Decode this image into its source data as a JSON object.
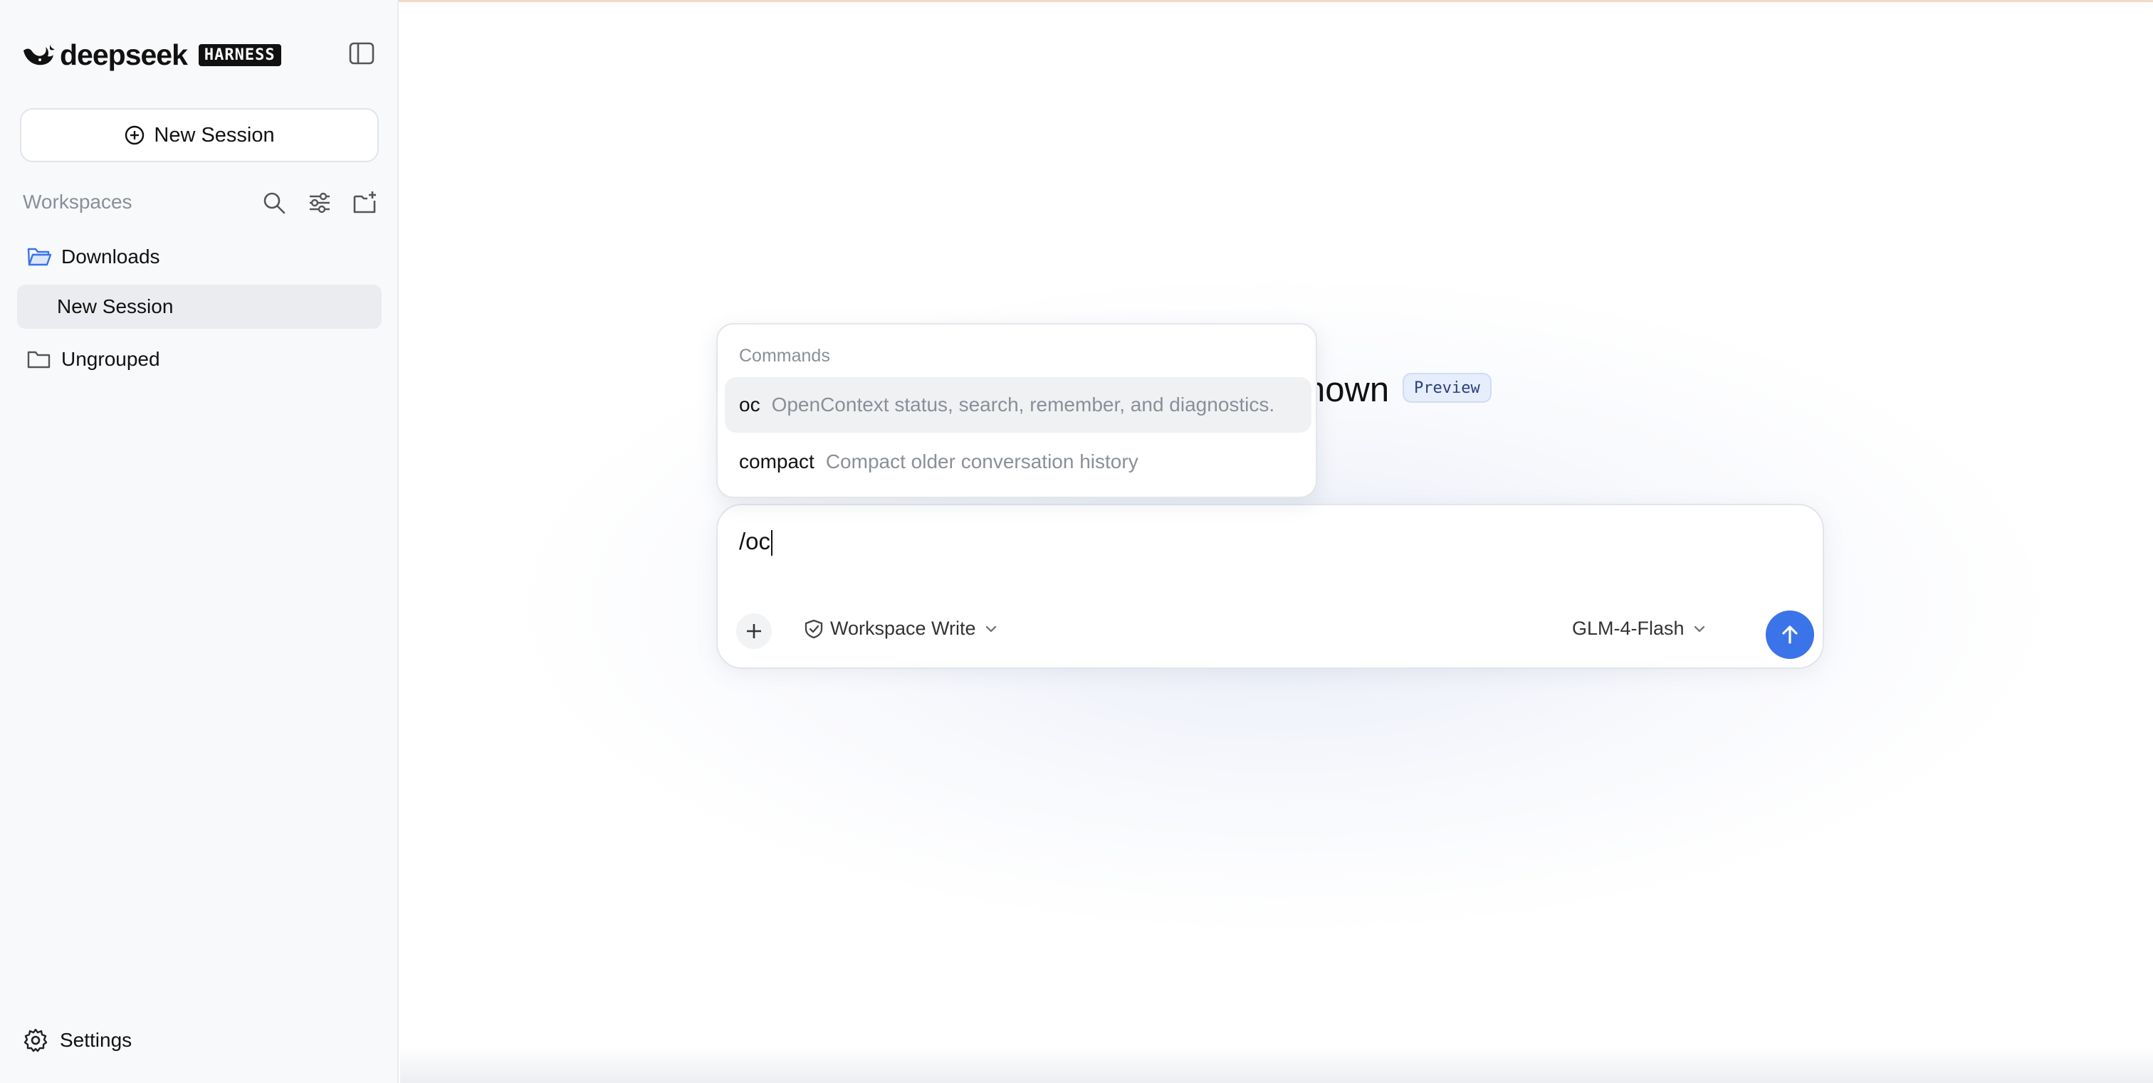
{
  "brand": {
    "name": "deepseek",
    "badge": "HARNESS"
  },
  "sidebar": {
    "new_session_label": "New Session",
    "workspaces_title": "Workspaces",
    "items": [
      {
        "label": "Downloads"
      },
      {
        "label": "New Session"
      },
      {
        "label": "Ungrouped"
      }
    ],
    "settings_label": "Settings"
  },
  "main": {
    "heading_fragment": "nown",
    "preview_badge": "Preview"
  },
  "commands": {
    "title": "Commands",
    "items": [
      {
        "name": "oc",
        "description": "OpenContext status, search, remember, and diagnostics."
      },
      {
        "name": "compact",
        "description": "Compact older conversation history"
      }
    ]
  },
  "composer": {
    "input_value": "/oc",
    "permission_mode": "Workspace Write",
    "model": "GLM-4-Flash"
  },
  "colors": {
    "accent": "#3b73e8",
    "sidebar_bg": "#f8f9fb",
    "selected_row": "#ebecef"
  }
}
